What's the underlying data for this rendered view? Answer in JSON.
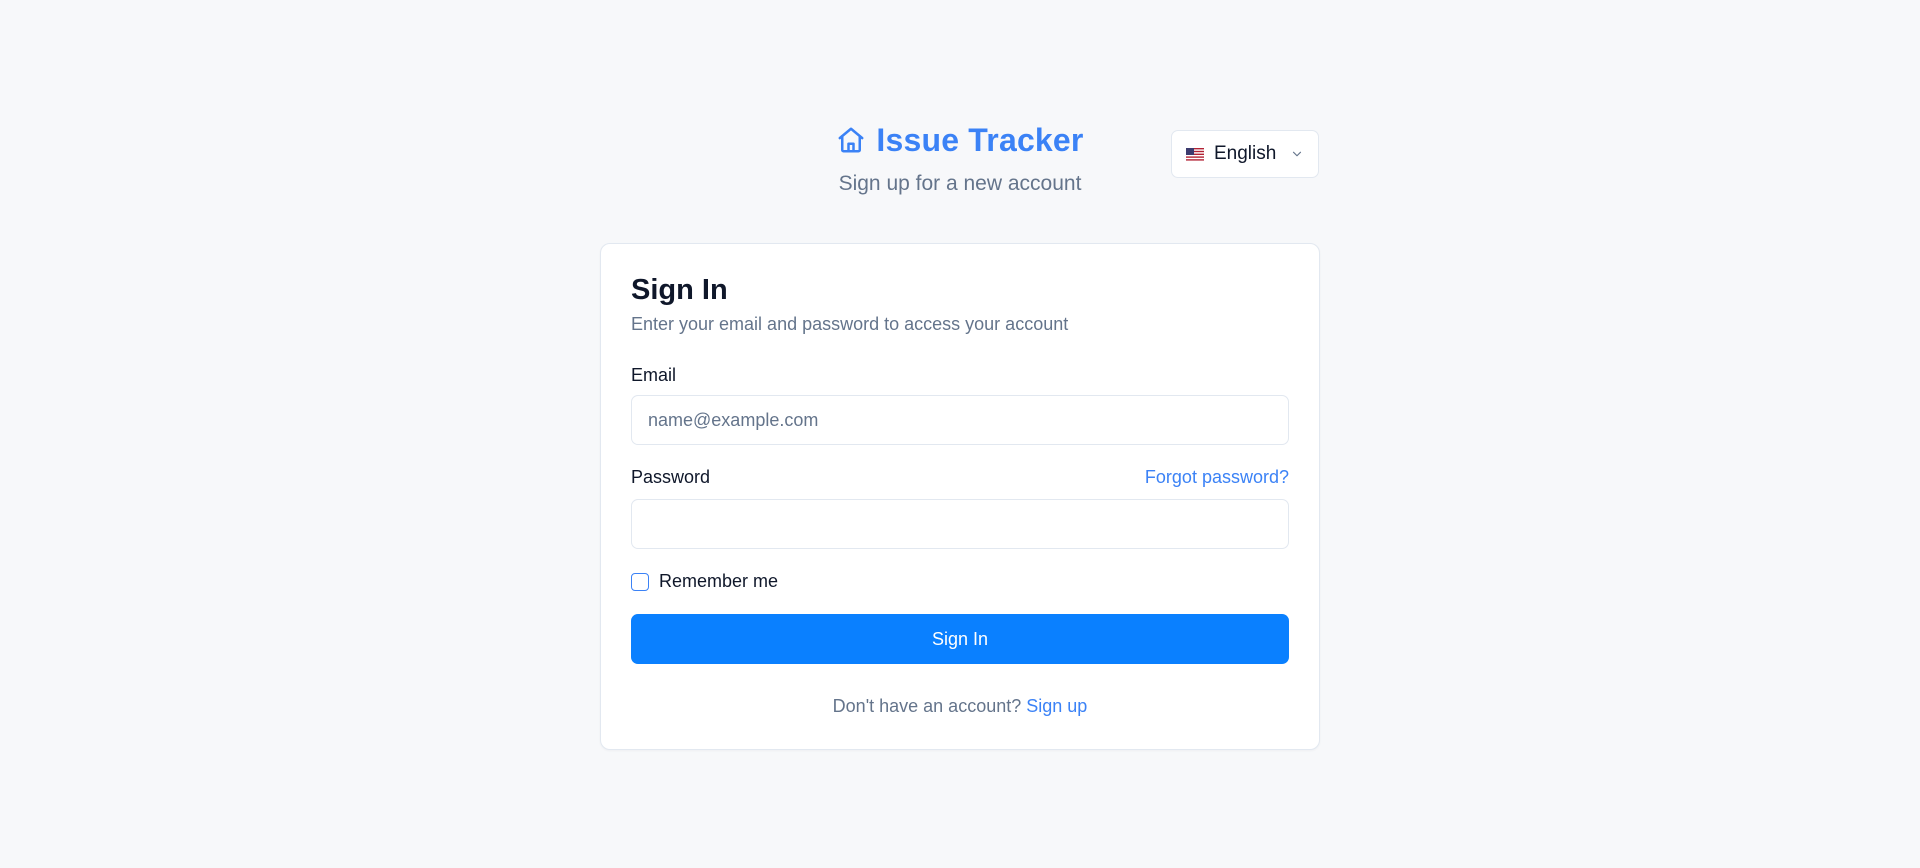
{
  "app": {
    "title": "Issue Tracker",
    "subtitle": "Sign up for a new account",
    "icon": "home-icon",
    "accent_color": "#3b82f6"
  },
  "language_selector": {
    "selected": "English",
    "flag_icon": "us-flag-icon",
    "chevron_icon": "chevron-down-icon"
  },
  "signin_card": {
    "title": "Sign In",
    "description": "Enter your email and password to access your account",
    "email": {
      "label": "Email",
      "placeholder": "name@example.com",
      "value": ""
    },
    "password": {
      "label": "Password",
      "placeholder": "",
      "value": ""
    },
    "forgot_password_label": "Forgot password?",
    "remember_me_label": "Remember me",
    "remember_me_checked": false,
    "submit_label": "Sign In",
    "submit_color": "#0a80ff",
    "footer_prompt": "Don't have an account?",
    "signup_label": "Sign up"
  }
}
